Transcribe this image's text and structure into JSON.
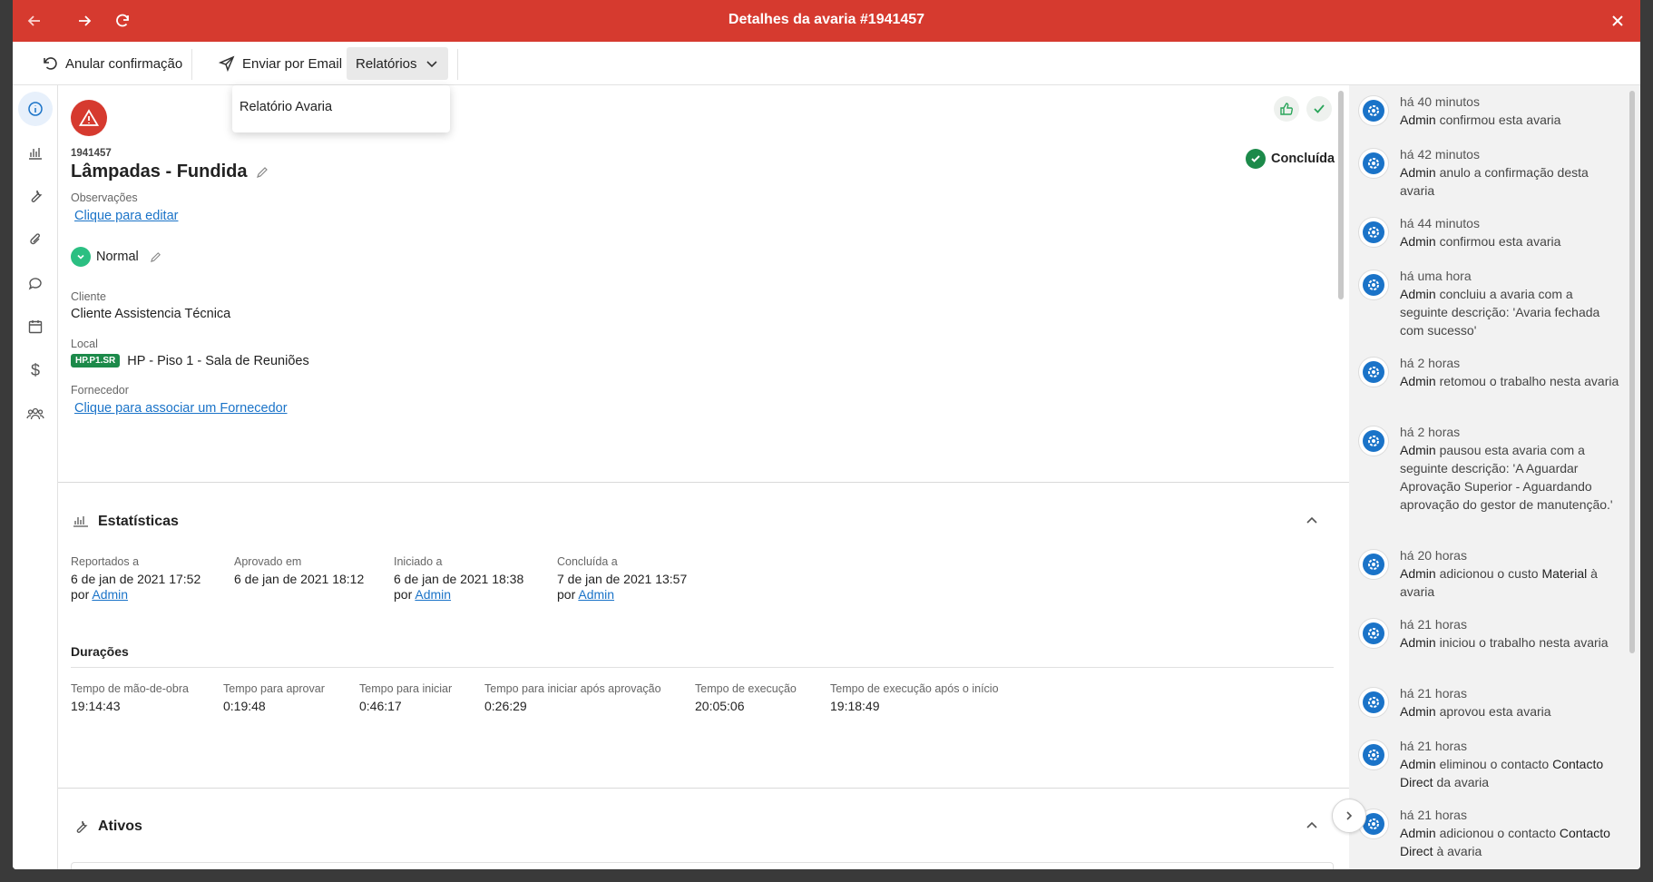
{
  "window": {
    "title": "Detalhes da avaria #1941457"
  },
  "toolbar": {
    "undo_confirm": "Anular confirmação",
    "send_email": "Enviar por Email",
    "reports": "Relatórios"
  },
  "dropdown": {
    "items": [
      "Relatório Avaria"
    ]
  },
  "fault": {
    "id": "1941457",
    "title": "Lâmpadas - Fundida",
    "status": "Concluída",
    "status_color": "#1c8a4a",
    "observations_label": "Observações",
    "observations_link": "Clique para editar",
    "priority": "Normal",
    "client_label": "Cliente",
    "client": "Cliente Assistencia Técnica",
    "location_label": "Local",
    "location_code": "HP.P1.SR",
    "location": "HP - Piso 1 - Sala de Reuniões",
    "supplier_label": "Fornecedor",
    "supplier_link": "Clique para associar um Fornecedor"
  },
  "stats": {
    "title": "Estatísticas",
    "by_word": "por",
    "items": [
      {
        "label": "Reportados a",
        "date": "6 de jan de 2021 17:52",
        "user": "Admin"
      },
      {
        "label": "Aprovado em",
        "date": "6 de jan de 2021 18:12",
        "user": ""
      },
      {
        "label": "Iniciado a",
        "date": "6 de jan de 2021 18:38",
        "user": "Admin"
      },
      {
        "label": "Concluída a",
        "date": "7 de jan de 2021 13:57",
        "user": "Admin"
      }
    ],
    "durations_title": "Durações",
    "durations": [
      {
        "label": "Tempo de mão-de-obra",
        "value": "19:14:43"
      },
      {
        "label": "Tempo para aprovar",
        "value": "0:19:48"
      },
      {
        "label": "Tempo para iniciar",
        "value": "0:46:17"
      },
      {
        "label": "Tempo para iniciar após aprovação",
        "value": "0:26:29"
      },
      {
        "label": "Tempo de execução",
        "value": "20:05:06"
      },
      {
        "label": "Tempo de execução após o início",
        "value": "19:18:49"
      }
    ]
  },
  "assets": {
    "title": "Ativos"
  },
  "activity": [
    {
      "time": "há 40 minutos",
      "user": "Admin",
      "text": " confirmou esta avaria"
    },
    {
      "time": "há 42 minutos",
      "user": "Admin",
      "text": " anulo a confirmação desta avaria"
    },
    {
      "time": "há 44 minutos",
      "user": "Admin",
      "text": " confirmou esta avaria"
    },
    {
      "time": "há uma hora",
      "user": "Admin",
      "text": " concluiu a avaria com a seguinte descrição: 'Avaria fechada com sucesso'"
    },
    {
      "time": "há 2 horas",
      "user": "Admin",
      "text": " retomou o trabalho nesta avaria"
    },
    {
      "time": "há 2 horas",
      "user": "Admin",
      "text": " pausou esta avaria com a seguinte descrição: 'A Aguardar Aprovação Superior - Aguardando aprovação do gestor de manutenção.'"
    },
    {
      "time": "há 20 horas",
      "user": "Admin",
      "text": " adicionou o custo ",
      "strong": "Material",
      "tail": " à avaria"
    },
    {
      "time": "há 21 horas",
      "user": "Admin",
      "text": " iniciou o trabalho nesta avaria"
    },
    {
      "time": "há 21 horas",
      "user": "Admin",
      "text": " aprovou esta avaria"
    },
    {
      "time": "há 21 horas",
      "user": "Admin",
      "text": " eliminou o contacto ",
      "strong": "Contacto Direct",
      "tail": " da avaria"
    },
    {
      "time": "há 21 horas",
      "user": "Admin",
      "text": " adicionou o contacto ",
      "strong": "Contacto Direct",
      "tail": " à avaria"
    }
  ],
  "colors": {
    "titlebar": "#d63a2f",
    "accent": "#1a73c8",
    "success": "#1c8a4a"
  }
}
